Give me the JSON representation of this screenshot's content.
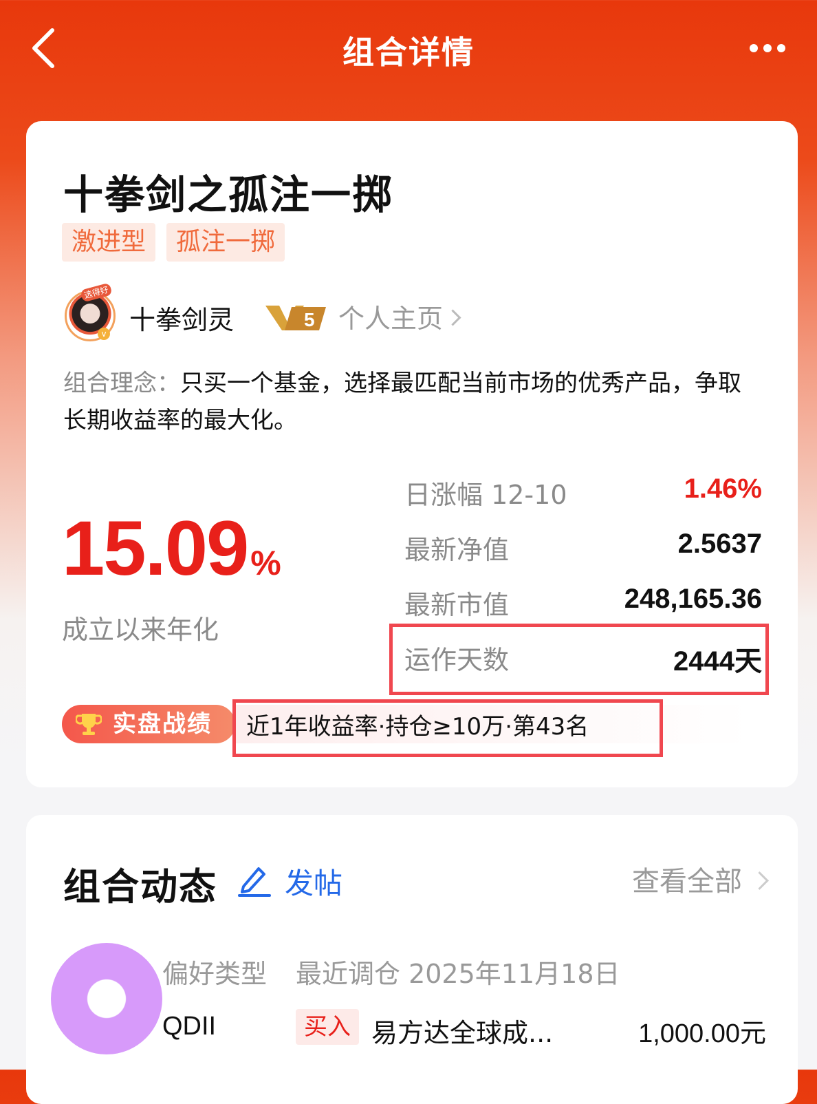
{
  "header": {
    "title": "组合详情"
  },
  "portfolio": {
    "name": "十拳剑之孤注一掷",
    "tags": [
      "激进型",
      "孤注一掷"
    ],
    "owner": {
      "name": "十拳剑灵",
      "avatar_badge": "选得好",
      "vip_level": "5",
      "home_link": "个人主页"
    },
    "philosophy_label": "组合理念：",
    "philosophy_text": "只买一个基金，选择最匹配当前市场的优秀产品，争取长期收益率的最大化。",
    "annualized_return": "15.09",
    "annualized_unit": "%",
    "annualized_label": "成立以来年化",
    "stats": [
      {
        "label": "日涨幅 12-10",
        "value": "1.46%",
        "color": "#e8201a"
      },
      {
        "label": "最新净值",
        "value": "2.5637"
      },
      {
        "label": "最新市值",
        "value": "248,165.36"
      },
      {
        "label": "运作天数",
        "value": "2444天"
      }
    ],
    "award_label": "实盘战绩",
    "award_rank": "近1年收益率·持仓≥10万·第43名"
  },
  "dynamics": {
    "title": "组合动态",
    "post_label": "发帖",
    "view_all": "查看全部",
    "pref_label": "偏好类型",
    "pref_value": "QDII",
    "rebalance_label": "最近调仓 2025年11月18日",
    "action": "买入",
    "fund_name": "易方达全球成...",
    "amount": "1,000.00元",
    "donut_color": "#d79afa"
  },
  "colors": {
    "brand": "#e8380c",
    "up": "#e8201a",
    "link": "#2469e8",
    "highlight_box": "#f0474f"
  }
}
